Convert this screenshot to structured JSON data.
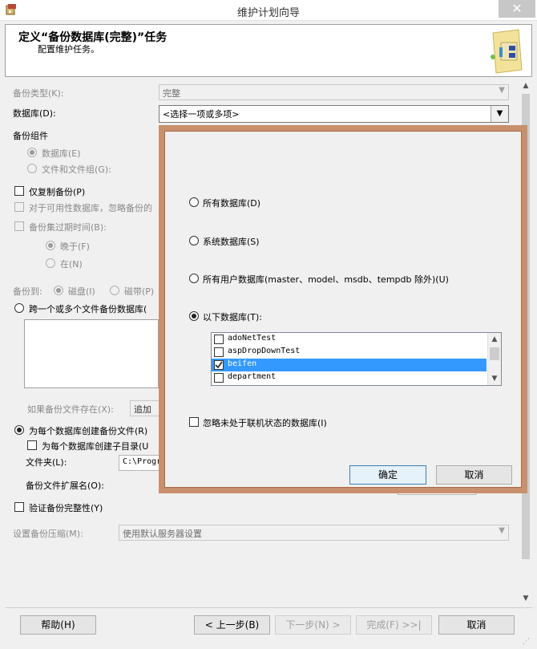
{
  "window": {
    "title": "维护计划向导",
    "close_symbol": "✕"
  },
  "header": {
    "title": "定义“备份数据库(完整)”任务",
    "subtitle": "配置维护任务。",
    "icon": "wizard-icon"
  },
  "form": {
    "backup_type_label": "备份类型(K):",
    "backup_type_value": "完整",
    "database_label": "数据库(D):",
    "database_value": "<选择一项或多项>",
    "backup_component_label": "备份组件",
    "component_database": "数据库(E)",
    "component_files": "文件和文件组(G):",
    "copy_only": "仅复制备份(P)",
    "availability_db": "对于可用性数据库，忽略备份的",
    "expire_label": "备份集过期时间(B):",
    "expire_after": "晚于(F)",
    "expire_on": "在(N)",
    "backup_to_label": "备份到:",
    "backup_to_disk": "磁盘(I)",
    "backup_to_tape": "磁带(P)",
    "span_files": "跨一个或多个文件备份数据库(",
    "if_exists_label": "如果备份文件存在(X):",
    "if_exists_value": "追加",
    "create_per_db": "为每个数据库创建备份文件(R)",
    "create_subdir": "为每个数据库创建子目录(U",
    "folder_label": "文件夹(L):",
    "folder_value": "C:\\Progr",
    "extension_label": "备份文件扩展名(O):",
    "verify": "验证备份完整性(Y)",
    "compression_label": "设置备份压缩(M):",
    "compression_value": "使用默认服务器设置"
  },
  "popup": {
    "all_databases": "所有数据库(D)",
    "system_databases": "系统数据库(S)",
    "user_databases": "所有用户数据库(master、model、msdb、tempdb 除外)(U)",
    "these_databases": "以下数据库(T):",
    "items": [
      {
        "name": "adoNetTest",
        "checked": false,
        "selected": false
      },
      {
        "name": "aspDropDownTest",
        "checked": false,
        "selected": false
      },
      {
        "name": "beifen",
        "checked": true,
        "selected": true
      },
      {
        "name": "department",
        "checked": false,
        "selected": false
      }
    ],
    "ignore_offline": "忽略未处于联机状态的数据库(I)",
    "ok": "确定",
    "cancel": "取消"
  },
  "footer": {
    "help": "帮助(H)",
    "back": "< 上一步(B)",
    "next": "下一步(N) >",
    "finish": "完成(F) >>|",
    "cancel": "取消"
  }
}
